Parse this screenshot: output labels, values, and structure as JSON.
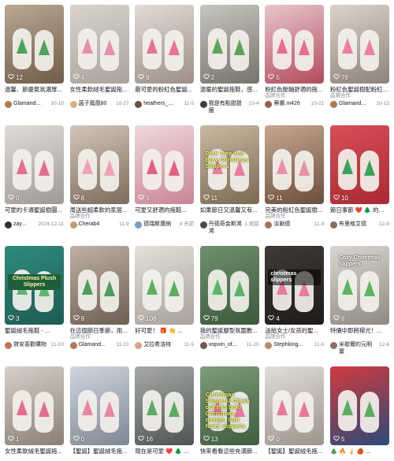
{
  "cards": [
    {
      "likes": "12",
      "caption": "温馨、節慶氣氛濃厚...",
      "tag": "",
      "author": "Glamand...",
      "date": "10-10",
      "c1": "#b9a894",
      "c2": "#6f5d4a",
      "tree": "#4ea35a",
      "avatar": "#b07a52",
      "overlay": ""
    },
    {
      "likes": "4",
      "caption": "女性柔軟絨毛聖誕拖...",
      "tag": "",
      "author": "菡子鳳凰80",
      "date": "10-27",
      "c1": "#d8d3ce",
      "c2": "#a9a39b",
      "tree": "#e98fae",
      "avatar": "#d9b08a",
      "overlay": ""
    },
    {
      "likes": "8",
      "caption": "最可愛的粉紅色聖誕...",
      "tag": "",
      "author": "heathers_...",
      "date": "11-5",
      "c1": "#e3dcd6",
      "c2": "#9c8f86",
      "tree": "#e8728f",
      "avatar": "#6a5142",
      "overlay": ""
    },
    {
      "likes": "2",
      "caption": "溫暖的聖誕拖鞋，感...",
      "tag": "",
      "author": "我是有點甜甜圈",
      "date": "10-4",
      "c1": "#c7c5bf",
      "c2": "#76736c",
      "tree": "#5da35b",
      "avatar": "#3e3e3e",
      "overlay": "",
      "overlay_class": ""
    },
    {
      "likes": "5",
      "caption": "粉紅色壓軸舒適的拖...",
      "tag": "品牌合作",
      "author": "蒂娜.m426",
      "date": "10-21",
      "c1": "#e8c6cc",
      "c2": "#b34b5c",
      "tree": "#e86f8c",
      "avatar": "#9b5e4d",
      "overlay": "",
      "overlay_class": ""
    },
    {
      "likes": "79",
      "caption": "粉紅色聖誕樹配粉紅...",
      "tag": "品牌合作",
      "author": "Glamand...",
      "date": "10-13",
      "c1": "#ddd3ca",
      "c2": "#8f8378",
      "tree": "#ec7fa0",
      "avatar": "#b07a52",
      "overlay": ""
    },
    {
      "likes": "0",
      "caption": "可愛的卡通聖誕樹圖...",
      "tag": "",
      "author": "zay...",
      "date": "2024-12-11",
      "c1": "#e0ddd9",
      "c2": "#9e9994",
      "tree": "#e46f8d",
      "avatar": "#2f2f2f",
      "overlay": ""
    },
    {
      "likes": "8",
      "caption": "周送些超柔軟的家居...",
      "tag": "品牌合作",
      "author": "Cherab4",
      "date": "11-9",
      "c1": "#d3c6ba",
      "c2": "#7d6b5c",
      "tree": "#f0a2b8",
      "avatar": "#c49a74",
      "overlay": ""
    },
    {
      "likes": "5",
      "caption": "可愛又舒適的拖鞋...",
      "tag": "",
      "author": "德瑞斯康納",
      "date": "4 天前",
      "c1": "#eed9dd",
      "c2": "#c98494",
      "tree": "#e5607f",
      "avatar": "#7a9ec4",
      "overlay": ""
    },
    {
      "likes": "11",
      "caption": "如果節日又溫馨又有...",
      "tag": "",
      "author": "丹德奇金斯鴻鴻",
      "date": "1 周前",
      "c1": "#c9b9a3",
      "c2": "#7a6a52",
      "tree": "#e97f9b",
      "avatar": "#4b4b4b",
      "overlay": "Pink Tree and Bow Christmas Slippers",
      "overlay_class": "ov-yellow"
    },
    {
      "likes": "11",
      "caption": "完美的粉紅色聖誕樹...",
      "tag": "品牌合作",
      "author": "淡勒德",
      "date": "11-9",
      "c1": "#c7a78f",
      "c2": "#6b4e3c",
      "tree": "#e98fa6",
      "avatar": "#a6765a",
      "overlay": ""
    },
    {
      "likes": "10",
      "caption": "節日事節 ❤️ 🌲 的完...",
      "tag": "",
      "author": "布里格艾德",
      "date": "12-8",
      "c1": "#d94e57",
      "c2": "#a82a33",
      "tree": "#3aa35b",
      "avatar": "#8c6b5a",
      "overlay": ""
    },
    {
      "likes": "3",
      "caption": "聖誕絨毛拖鞋 - ...",
      "tag": "",
      "author": "貸安喜歡購物",
      "date": "11-10",
      "c1": "#2e8b7d",
      "c2": "#1f5b55",
      "tree": "#5fb56a",
      "avatar": "#c4705a",
      "overlay": "Christmas Plush Slippers",
      "overlay_class": "ov-green"
    },
    {
      "likes": "9",
      "caption": "在這個節日季節，用...",
      "tag": "品牌合作",
      "author": "Glamand...",
      "date": "11-22",
      "c1": "#bfb1a4",
      "c2": "#6d5e52",
      "tree": "#4f9d5b",
      "avatar": "#b07a52",
      "overlay": ""
    },
    {
      "likes": "108",
      "caption": "好可愛！ 🎁 👏 ...",
      "tag": "",
      "author": "艾拉希洛特",
      "date": "11-5",
      "c1": "#e3e0da",
      "c2": "#a7a29a",
      "tree": "#5fae62",
      "avatar": "#d7a58a",
      "overlay": ""
    },
    {
      "likes": "79",
      "caption": "我的聖誕腳型氛圍數...",
      "tag": "品牌合作",
      "author": "vopxin_of...",
      "date": "11-20",
      "c1": "#6f8f6e",
      "c2": "#3b5a3c",
      "tree": "#5ab66a",
      "avatar": "#6e5b4c",
      "overlay": ""
    },
    {
      "likes": "4",
      "caption": "送給女士/女孩的聖...",
      "tag": "品牌合作",
      "author": "Stephking...",
      "date": "11-6",
      "c1": "#3e3a38",
      "c2": "#1e1b1a",
      "tree": "#e87aa0",
      "avatar": "#b98a6c",
      "overlay": "christmas slippers",
      "overlay_class": ""
    },
    {
      "likes": "6",
      "caption": "特價中即將掃光！...",
      "tag": "",
      "author": "米歇爾的元明薑",
      "date": "12-6",
      "c1": "#d9d6d1",
      "c2": "#8e8982",
      "tree": "#5db463",
      "avatar": "#8d6e63",
      "overlay": "Cozy Christmas Slippers",
      "overlay_class": "ov-white"
    },
    {
      "likes": "1",
      "caption": "女性柔軟絨毛聖誕拖...",
      "tag": "",
      "author": "",
      "date": "",
      "c1": "#d7cfc8",
      "c2": "#8a8076",
      "tree": "#e46f8d",
      "avatar": "#cccccc",
      "overlay": ""
    },
    {
      "likes": "0",
      "caption": "【聖誕】聖誕絨毛拖...",
      "tag": "",
      "author": "",
      "date": "",
      "c1": "#cfd6e0",
      "c2": "#7e8794",
      "tree": "#e987a3",
      "avatar": "#cccccc",
      "overlay": ""
    },
    {
      "likes": "16",
      "caption": "現在是可愛 ❤️ 🌲 拖...",
      "tag": "",
      "author": "",
      "date": "",
      "c1": "#a7aaa8",
      "c2": "#4f5452",
      "tree": "#5cab62",
      "avatar": "#cccccc",
      "overlay": ""
    },
    {
      "likes": "13",
      "caption": "快來看看這些充滿節...",
      "tag": "",
      "author": "",
      "date": "",
      "c1": "#7e9d7a",
      "c2": "#3e5d3d",
      "tree": "#e87aa0",
      "avatar": "#cccccc",
      "overlay": "Christmas Slippers! Check out this bold Christmas design. Soft fuzzy slippers.",
      "overlay_class": "ov-yellow"
    },
    {
      "likes": "0",
      "caption": "【聖誕】聖誕絨毛拖...",
      "tag": "",
      "author": "",
      "date": "",
      "c1": "#e2ddd8",
      "c2": "#9d958c",
      "tree": "#e6789a",
      "avatar": "#cccccc",
      "overlay": ""
    },
    {
      "likes": "5",
      "caption": "🎄 🔥 🍦 🍎 ...",
      "tag": "",
      "author": "",
      "date": "",
      "c1": "#d13a3f",
      "c2": "#2c4a78",
      "tree": "#5cab62",
      "avatar": "#cccccc",
      "overlay": ""
    }
  ]
}
